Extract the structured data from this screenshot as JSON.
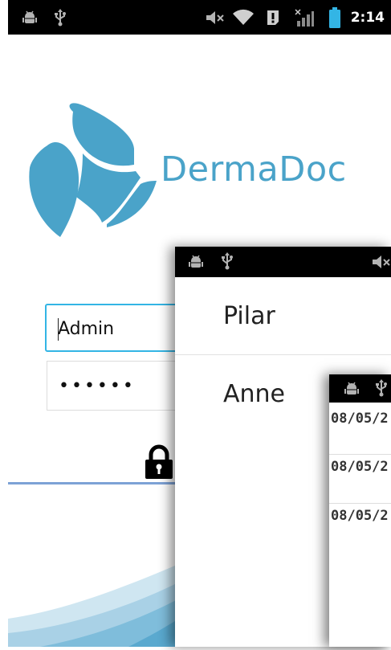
{
  "status_bar": {
    "time": "2:14",
    "icons": [
      "android-debug-icon",
      "usb-icon",
      "volume-muted-icon",
      "wifi-icon",
      "alert-icon",
      "signal-off-icon",
      "battery-icon"
    ]
  },
  "login": {
    "brand_name": "DermaDoc",
    "username_value": "Admin",
    "password_value": "••••••",
    "lock_icon": "lock-icon",
    "brand_color": "#4aa3c9",
    "focus_color": "#33b5e5"
  },
  "patient_list": {
    "status_icons": [
      "android-debug-icon",
      "usb-icon",
      "volume-muted-icon"
    ],
    "items": [
      {
        "name": "Pilar"
      },
      {
        "name": "Anne"
      }
    ]
  },
  "visit_list": {
    "status_icons": [
      "android-debug-icon",
      "usb-icon"
    ],
    "dates": [
      "08/05/2",
      "08/05/2",
      "08/05/2"
    ]
  }
}
